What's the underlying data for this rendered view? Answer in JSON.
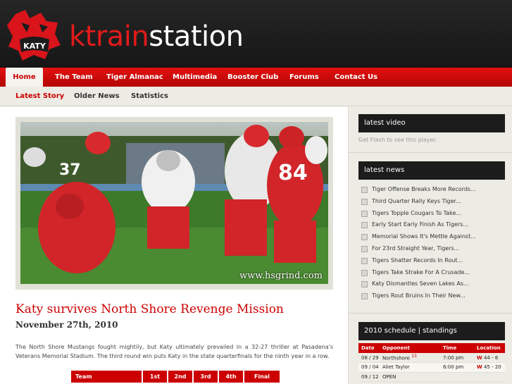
{
  "site": {
    "title_red": "ktrain",
    "title_white": "station",
    "logo_text": "KATY"
  },
  "main_nav": [
    {
      "label": "Home",
      "active": true
    },
    {
      "label": "The Team"
    },
    {
      "label": "Tiger Almanac"
    },
    {
      "label": "Multimedia"
    },
    {
      "label": "Booster Club"
    },
    {
      "label": "Forums"
    },
    {
      "label": "Contact Us"
    }
  ],
  "sub_nav": [
    {
      "label": "Latest Story",
      "active": true
    },
    {
      "label": "Older News"
    },
    {
      "label": "Statistics"
    }
  ],
  "article": {
    "photo_credit": "www.hsgrind.com",
    "jersey_numbers": [
      "37",
      "84"
    ],
    "headline": "Katy survives North Shore Revenge Mission",
    "date": "November 27th, 2010",
    "body": "The North Shore Mustangs fought mightily, but Katy ultimately prevailed in a 32-27 thriller at Pasadena's Veterans Memorial Stadium. The third round win puts Katy in the state quarterfinals for the ninth year in a row.",
    "score_headers": [
      "Team",
      "1st",
      "2nd",
      "3rd",
      "4th",
      "Final"
    ]
  },
  "sidebar": {
    "video_title": "latest video",
    "flash_text": "Get Flash to see this player.",
    "news_title": "latest news",
    "news": [
      "Tiger Offense Breaks More Records...",
      "Third Quarter Rally Keys Tiger...",
      "Tigers Topple Cougars To Take...",
      "Early Start Early Finish As Tigers...",
      "Memorial Shows It's Mettle Against...",
      "For 23rd Straight Year, Tigers...",
      "Tigers Shatter Records In Rout...",
      "Tigers Take Strake For A Crusade...",
      "Katy Dismantles Seven Lakes As...",
      "Tigers Rout Bruins In Their New..."
    ],
    "schedule_title": "2010 schedule | standings",
    "schedule_headers": [
      "Date",
      "Opponent",
      "Time",
      "Location"
    ],
    "schedule": [
      {
        "date": "08 / 29",
        "opponent": "Northshore",
        "rank": "13",
        "time": "7:00 pm",
        "result": "W",
        "score": "44 - 6"
      },
      {
        "date": "09 / 04",
        "opponent": "Aliet Taylor",
        "rank": "",
        "time": "6:00 pm",
        "result": "W",
        "score": "45 - 20"
      },
      {
        "date": "09 / 12",
        "opponent": "OPEN",
        "rank": "",
        "time": "",
        "result": "",
        "score": ""
      }
    ]
  },
  "colors": {
    "brand_red": "#cc0000",
    "header_dark": "#1c1c1c",
    "page_bg": "#f4f3ee"
  }
}
